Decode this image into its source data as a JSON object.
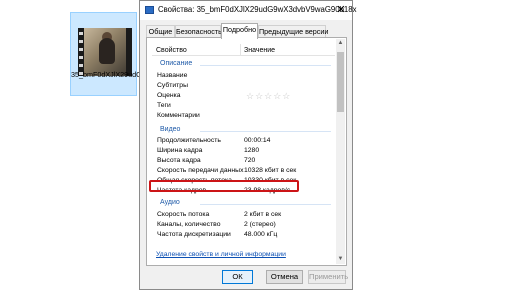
{
  "file": {
    "label": "35_bmF0dXJlX29udG9wX3dvbV9waG90b18x"
  },
  "dialog": {
    "title": "Свойства: 35_bmF0dXJlX29udG9wX3dvbV9waG90b18x",
    "close_glyph": "✕",
    "tabs": [
      "Общие",
      "Безопасность",
      "Подробно",
      "Предыдущие версии"
    ],
    "active_tab": "Подробно",
    "columns": {
      "property": "Свойство",
      "value": "Значение"
    },
    "groups": {
      "description": "Описание",
      "video": "Видео",
      "audio": "Аудио"
    },
    "description_rows": [
      {
        "property": "Название",
        "value": ""
      },
      {
        "property": "Субтитры",
        "value": ""
      },
      {
        "property": "Оценка",
        "value": "☆☆☆☆☆"
      },
      {
        "property": "Теги",
        "value": ""
      },
      {
        "property": "Комментарии",
        "value": ""
      }
    ],
    "video_rows": [
      {
        "property": "Продолжительность",
        "value": "00:00:14"
      },
      {
        "property": "Ширина кадра",
        "value": "1280"
      },
      {
        "property": "Высота кадра",
        "value": "720"
      },
      {
        "property": "Скорость передачи данных",
        "value": "10328 кбит в сек"
      },
      {
        "property": "Общая скорость потока",
        "value": "10330 кбит в сек"
      },
      {
        "property": "Частота кадров",
        "value": "23.98 кадров/с"
      }
    ],
    "audio_rows": [
      {
        "property": "Скорость потока",
        "value": "2 кбит в сек"
      },
      {
        "property": "Каналы, количество",
        "value": "2 (стерео)"
      },
      {
        "property": "Частота дискретизации",
        "value": "48.000 кГц"
      }
    ],
    "remove_link": "Удаление свойств и личной информации",
    "buttons": {
      "ok": "ОК",
      "cancel": "Отмена",
      "apply": "Применить"
    },
    "highlight_color": "#cc1417"
  }
}
